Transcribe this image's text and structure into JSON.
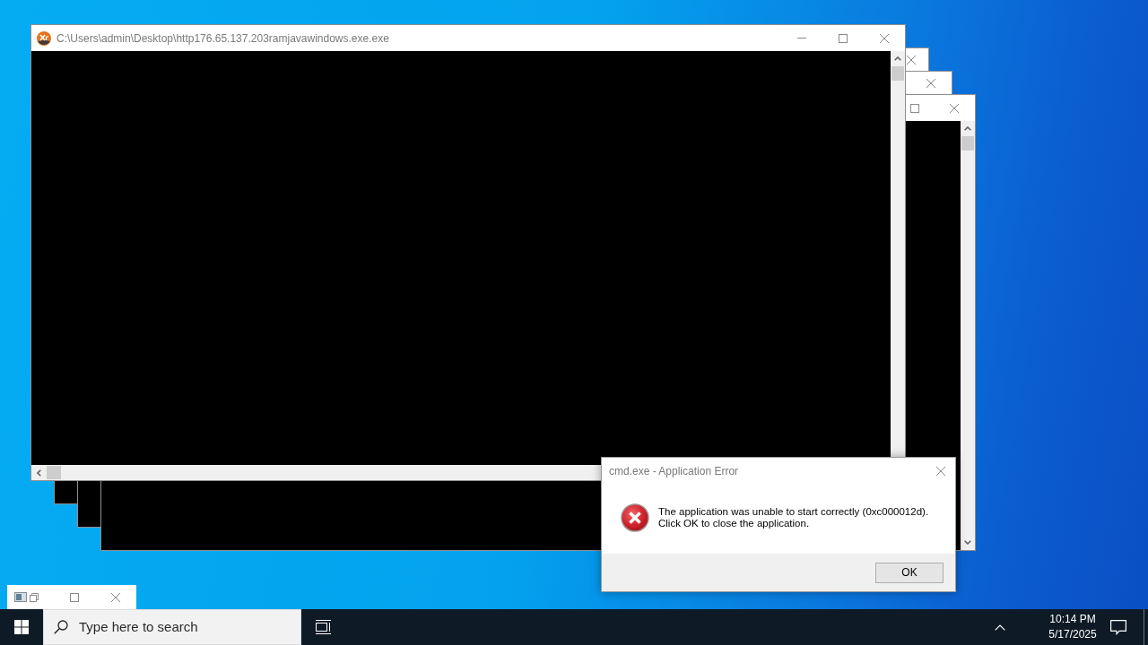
{
  "windows": [
    {
      "kind": "console",
      "buttons": [
        {
          "kind": "close"
        }
      ],
      "horizontal_scrollbar": false
    },
    {
      "kind": "console",
      "buttons": [
        {
          "kind": "close"
        }
      ],
      "horizontal_scrollbar": false
    },
    {
      "kind": "console",
      "buttons": [
        {
          "kind": "maximize"
        },
        {
          "kind": "close"
        }
      ],
      "vertical_scrollbar": true,
      "horizontal_scrollbar": false
    },
    {
      "kind": "console",
      "title": "C:\\Users\\admin\\Desktop\\http176.65.137.203ramjavawindows.exe.exe",
      "buttons": [
        {
          "kind": "minimize"
        },
        {
          "kind": "maximize"
        },
        {
          "kind": "close"
        }
      ],
      "vertical_scrollbar": true,
      "horizontal_scrollbar": true
    }
  ],
  "dialog": {
    "kind": "error",
    "title": "cmd.exe - Application Error",
    "message": [
      "The application was unable to start correctly (0xc000012d).",
      "Click OK to close the application."
    ],
    "buttons": [
      "OK"
    ]
  },
  "minimized_window": {
    "buttons": [
      {
        "kind": "restore"
      },
      {
        "kind": "maximize"
      },
      {
        "kind": "close"
      }
    ]
  },
  "taskbar": {
    "search": {
      "placeholder": "Type here to search"
    },
    "clock": {
      "time": "10:14 PM",
      "date": "5/17/2025"
    }
  }
}
